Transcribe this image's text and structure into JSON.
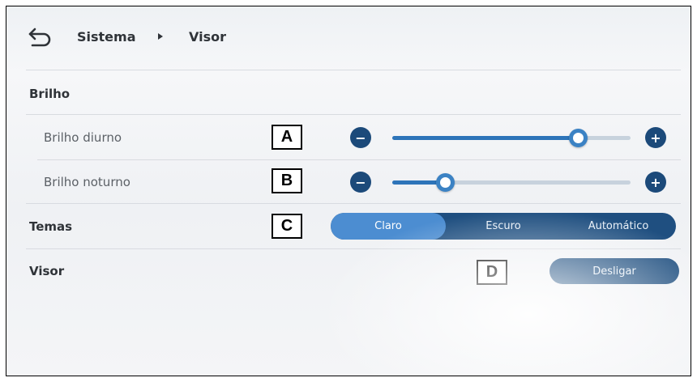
{
  "header": {
    "back_icon": "back-arrow-icon",
    "breadcrumb": [
      "Sistema",
      "Visor"
    ],
    "separator_icon": "caret-right-icon"
  },
  "brightness": {
    "title": "Brilho",
    "day": {
      "label": "Brilho diurno",
      "tag": "A",
      "value": 0.78
    },
    "night": {
      "label": "Brilho noturno",
      "tag": "B",
      "value": 0.22
    },
    "minus_icon": "minus-icon",
    "plus_icon": "plus-icon"
  },
  "themes": {
    "title": "Temas",
    "tag": "C",
    "options": [
      "Claro",
      "Escuro",
      "Automático"
    ],
    "selected": "Claro"
  },
  "display": {
    "title": "Visor",
    "tag": "D",
    "button_label": "Desligar"
  },
  "colors": {
    "accent": "#3b82c4",
    "dark_button": "#1f4f80",
    "active_segment": "#4c8dd1"
  }
}
